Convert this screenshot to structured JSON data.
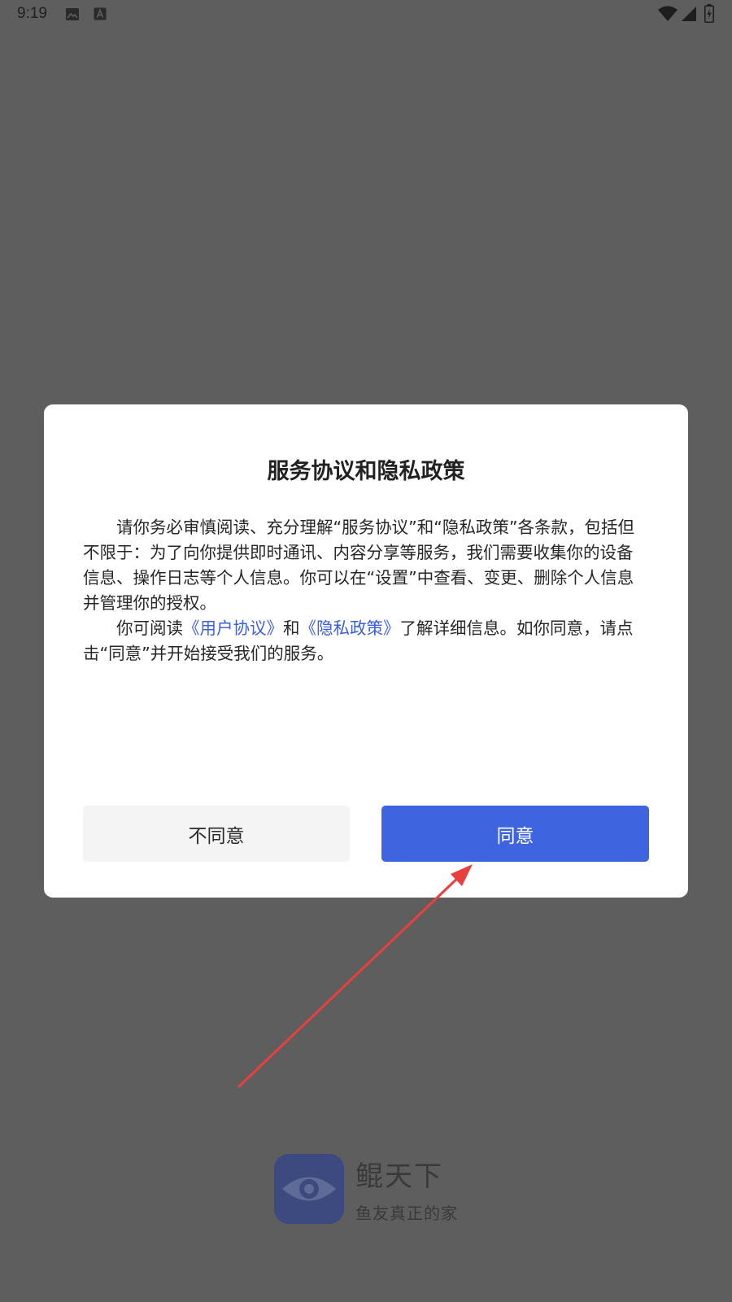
{
  "status_bar": {
    "time": "9:19",
    "icons": [
      "photo-icon",
      "a-icon",
      "wifi-icon",
      "signal-icon",
      "battery-charging-icon"
    ]
  },
  "dialog": {
    "title": "服务协议和隐私政策",
    "paragraph1": "请你务必审慎阅读、充分理解“服务协议”和“隐私政策”各条款，包括但不限于：为了向你提供即时通讯、内容分享等服务，我们需要收集你的设备信息、操作日志等个人信息。你可以在“设置”中查看、变更、删除个人信息并管理你的授权。",
    "paragraph2_prefix": "你可阅读",
    "user_agreement_link": "《用户协议》",
    "and_text": "和",
    "privacy_policy_link": "《隐私政策》",
    "paragraph2_suffix": "了解详细信息。如你同意，请点击“同意”并开始接受我们的服务。",
    "disagree_label": "不同意",
    "agree_label": "同意"
  },
  "splash": {
    "app_name": "鲲天下",
    "tagline": "鱼友真正的家",
    "logo_icon": "eye-fish-icon"
  },
  "colors": {
    "overlay_background": "#5e5e5e",
    "dialog_background": "#ffffff",
    "agree_button": "#3e64df",
    "disagree_button": "#f4f4f4",
    "link": "#3d5fdf",
    "annotation_arrow": "#e8403f",
    "logo_background": "#3c4a80"
  }
}
